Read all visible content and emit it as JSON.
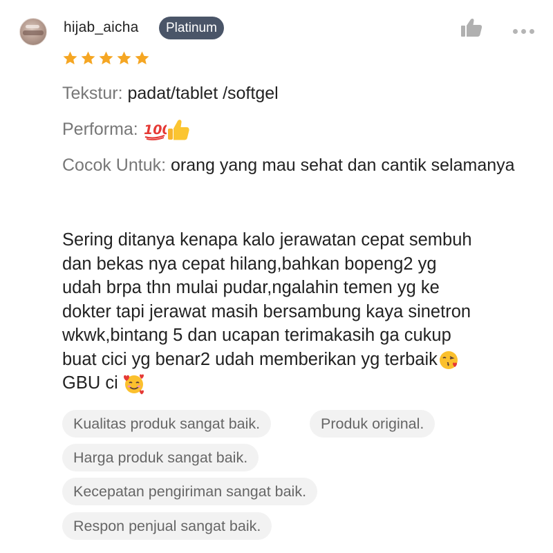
{
  "review": {
    "username": "hijab_aicha",
    "tier_badge": "Platinum",
    "rating": 5,
    "rating_max": 5,
    "star_color": "#f5a623",
    "fields": [
      {
        "label": "Tekstur:",
        "value": " padat/tablet /softgel"
      },
      {
        "label": "Performa:",
        "value": " "
      },
      {
        "label": "Cocok Untuk:",
        "value": " orang yang mau sehat dan cantik selamanya"
      }
    ],
    "body_lines": [
      "Sering ditanya kenapa kalo jerawatan cepat sembuh",
      "dan bekas nya cepat hilang,bahkan bopeng2 yg",
      "udah brpa thn mulai pudar,ngalahin temen yg ke",
      "dokter tapi jerawat masih bersambung kaya sinetron",
      "wkwk,bintang 5 dan ucapan terimakasih ga cukup",
      "buat cici yg benar2 udah memberikan yg terbaik",
      "GBU ci "
    ],
    "tags": [
      "Kualitas produk sangat baik.",
      "Produk original.",
      "Harga produk sangat baik.",
      "Kecepatan pengiriman sangat baik.",
      "Respon penjual sangat baik."
    ],
    "icons": {
      "like": "thumbs-up-icon",
      "more": "more-options-icon",
      "emoji_hundred": "hundred-points-emoji",
      "emoji_thumbs": "thumbs-up-emoji",
      "emoji_kiss": "face-blowing-kiss-emoji",
      "emoji_hearts": "smiling-face-with-hearts-emoji"
    },
    "colors": {
      "badge_bg": "#4a5568",
      "tag_bg": "#f2f2f2",
      "label_text": "#777777"
    }
  }
}
